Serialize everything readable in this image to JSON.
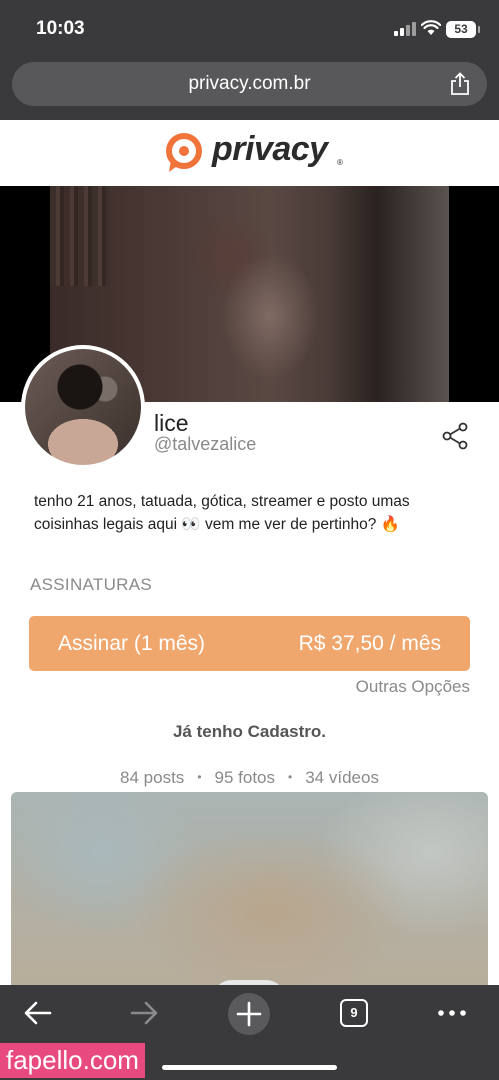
{
  "status_bar": {
    "time": "10:03",
    "battery": "53"
  },
  "browser": {
    "url": "privacy.com.br",
    "tab_count": "9"
  },
  "brand": {
    "name": "privacy",
    "reg": "®",
    "accent": "#f0743a"
  },
  "profile": {
    "name": "lice",
    "handle": "@talvezalice",
    "bio": "tenho 21 anos, tatuada, gótica, streamer e posto umas coisinhas legais aqui 👀 vem me ver de pertinho? 🔥"
  },
  "subscriptions": {
    "title": "ASSINATURAS",
    "button_label": "Assinar (1 mês)",
    "button_price": "R$ 37,50 / mês",
    "button_color": "#f0a76d",
    "other_options": "Outras Opções",
    "already_registered": "Já tenho Cadastro."
  },
  "stats": {
    "posts": "84 posts",
    "photos": "95 fotos",
    "videos": "34 vídeos",
    "separator": "•"
  },
  "watermark": "fapello.com"
}
